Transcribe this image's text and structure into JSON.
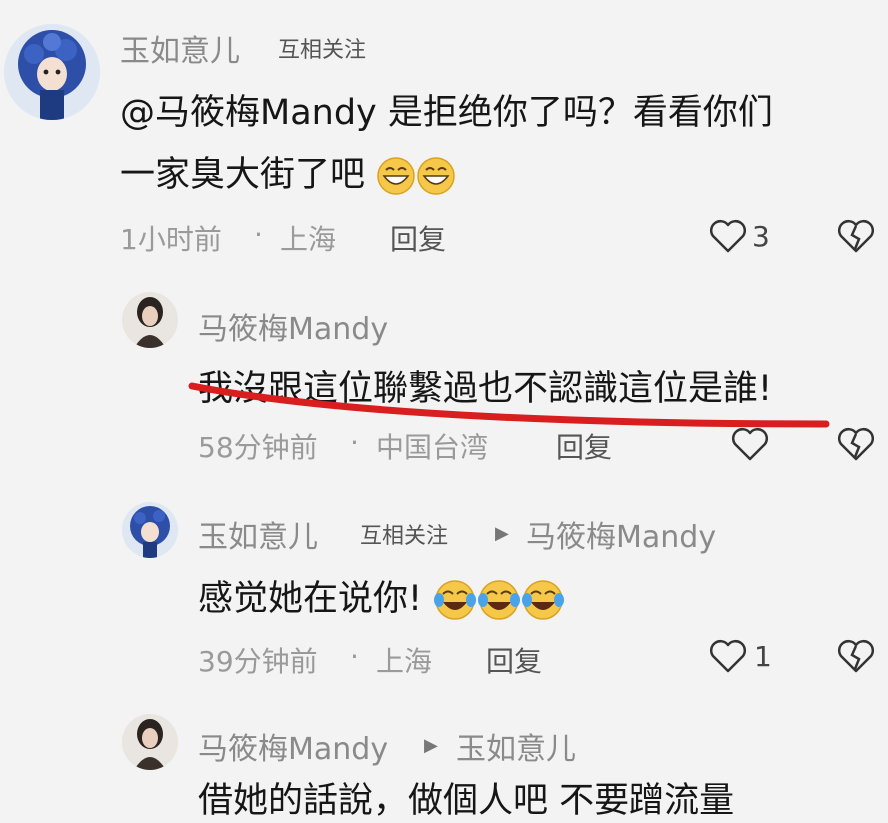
{
  "comment1": {
    "author": "玉如意儿",
    "badge": "互相关注",
    "line1": "@马筱梅Mandy 是拒绝你了吗？看看你们",
    "line2": "一家臭大街了吧",
    "time": "1小时前",
    "separator": "·",
    "location": "上海",
    "reply_label": "回复",
    "like_count": "3"
  },
  "reply1": {
    "author": "马筱梅Mandy",
    "text": "我沒跟這位聯繫過也不認識這位是誰!",
    "time": "58分钟前",
    "separator": "·",
    "location": "中国台湾",
    "reply_label": "回复"
  },
  "reply2": {
    "author": "玉如意儿",
    "badge": "互相关注",
    "reply_to": "马筱梅Mandy",
    "text": "感觉她在说你!",
    "time": "39分钟前",
    "separator": "·",
    "location": "上海",
    "reply_label": "回复",
    "like_count": "1"
  },
  "reply3": {
    "author": "马筱梅Mandy",
    "reply_to": "玉如意儿",
    "text": "借她的話說，做個人吧 不要蹭流量"
  },
  "colors": {
    "annotation_red": "#d81e1e",
    "avatar_blue": "#2e4fa8",
    "background": "#f3f3f3"
  }
}
